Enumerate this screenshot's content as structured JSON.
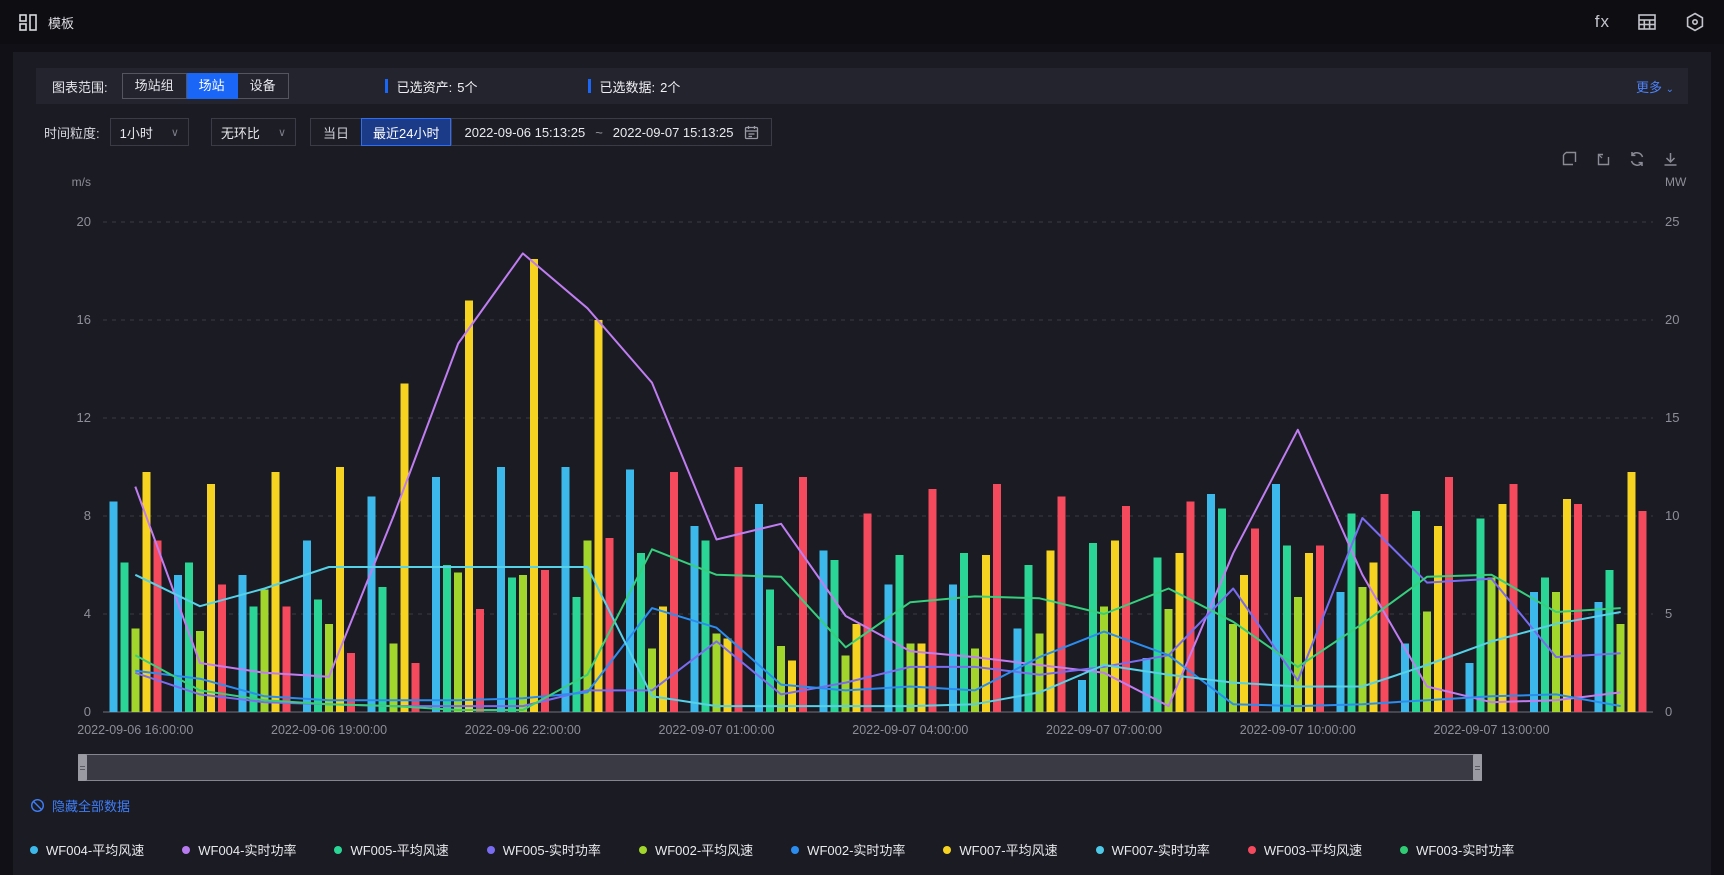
{
  "header": {
    "title": "模板",
    "fx_icon_label": "fx"
  },
  "filter": {
    "scope_label": "图表范围:",
    "scope_options": [
      "场站组",
      "场站",
      "设备"
    ],
    "scope_selected_index": 1,
    "assets_label": "已选资产:",
    "assets_value": "5个",
    "data_label": "已选数据:",
    "data_value": "2个",
    "more_label": "更多",
    "accent_color": "#1a66f7"
  },
  "time": {
    "granularity_label": "时间粒度:",
    "granularity_value": "1小时",
    "compare_value": "无环比",
    "today_label": "当日",
    "last24_label": "最近24小时",
    "range_start": "2022-09-06 15:13:25",
    "range_separator": "~",
    "range_end": "2022-09-07 15:13:25"
  },
  "footer": {
    "hide_all_label": "隐藏全部数据"
  },
  "legend": {
    "items": [
      {
        "label": "WF004-平均风速",
        "color": "#3cb9ea"
      },
      {
        "label": "WF004-实时功率",
        "color": "#b87af0"
      },
      {
        "label": "WF005-平均风速",
        "color": "#2bd596"
      },
      {
        "label": "WF005-实时功率",
        "color": "#7a6cf0"
      },
      {
        "label": "WF002-平均风速",
        "color": "#a2d62c"
      },
      {
        "label": "WF002-实时功率",
        "color": "#2b8df0"
      },
      {
        "label": "WF007-平均风速",
        "color": "#f6d321"
      },
      {
        "label": "WF007-实时功率",
        "color": "#4fc9e8"
      },
      {
        "label": "WF003-平均风速",
        "color": "#f5495e"
      },
      {
        "label": "WF003-实时功率",
        "color": "#30cc74"
      }
    ]
  },
  "chart_data": {
    "type": "mixed-bar-line",
    "grid": "dashed-horizontal",
    "x": [
      "2022-09-06 16:00:00",
      "2022-09-06 17:00:00",
      "2022-09-06 18:00:00",
      "2022-09-06 19:00:00",
      "2022-09-06 20:00:00",
      "2022-09-06 21:00:00",
      "2022-09-06 22:00:00",
      "2022-09-06 23:00:00",
      "2022-09-07 00:00:00",
      "2022-09-07 01:00:00",
      "2022-09-07 02:00:00",
      "2022-09-07 03:00:00",
      "2022-09-07 04:00:00",
      "2022-09-07 05:00:00",
      "2022-09-07 06:00:00",
      "2022-09-07 07:00:00",
      "2022-09-07 08:00:00",
      "2022-09-07 09:00:00",
      "2022-09-07 10:00:00",
      "2022-09-07 11:00:00",
      "2022-09-07 12:00:00",
      "2022-09-07 13:00:00",
      "2022-09-07 14:00:00",
      "2022-09-07 15:00:00"
    ],
    "x_tick_labels": [
      "2022-09-06 16:00:00",
      "2022-09-06 19:00:00",
      "2022-09-06 22:00:00",
      "2022-09-07 01:00:00",
      "2022-09-07 04:00:00",
      "2022-09-07 07:00:00",
      "2022-09-07 10:00:00",
      "2022-09-07 13:00:00"
    ],
    "x_tick_positions": [
      0,
      3,
      6,
      9,
      12,
      15,
      18,
      21
    ],
    "left_axis": {
      "unit": "m/s",
      "ticks": [
        0,
        4,
        8,
        12,
        16,
        20
      ],
      "min": 0,
      "max": 20
    },
    "right_axis": {
      "unit": "MW",
      "ticks": [
        0,
        5,
        10,
        15,
        20,
        25
      ],
      "min": 0,
      "max": 25
    },
    "bar_series": [
      {
        "name": "WF004-平均风速",
        "axis": "left",
        "color": "#3cb9ea",
        "values": [
          8.6,
          5.6,
          5.6,
          7.0,
          8.8,
          9.6,
          10.0,
          10.0,
          9.9,
          7.6,
          8.5,
          6.6,
          5.2,
          5.2,
          3.4,
          1.3,
          2.2,
          8.9,
          9.3,
          4.9,
          2.8,
          2.0,
          4.9,
          4.5
        ]
      },
      {
        "name": "WF005-平均风速",
        "axis": "left",
        "color": "#2bd596",
        "values": [
          6.1,
          6.1,
          4.3,
          4.6,
          5.1,
          6.0,
          5.5,
          4.7,
          6.5,
          7.0,
          5.0,
          6.2,
          6.4,
          6.5,
          6.0,
          6.9,
          6.3,
          8.3,
          6.8,
          8.1,
          8.2,
          7.9,
          5.5,
          5.8
        ]
      },
      {
        "name": "WF002-平均风速",
        "axis": "left",
        "color": "#a2d62c",
        "values": [
          3.4,
          3.3,
          5.0,
          3.6,
          2.8,
          5.7,
          5.6,
          7.0,
          2.6,
          3.2,
          2.7,
          2.3,
          2.8,
          2.6,
          3.2,
          4.3,
          4.2,
          3.6,
          4.7,
          5.1,
          4.1,
          5.5,
          4.9,
          3.6
        ]
      },
      {
        "name": "WF007-平均风速",
        "axis": "left",
        "color": "#f6d321",
        "values": [
          9.8,
          9.3,
          9.8,
          10.0,
          13.4,
          16.8,
          18.5,
          16.0,
          4.3,
          3.0,
          2.1,
          3.6,
          2.8,
          6.4,
          6.6,
          7.0,
          6.5,
          5.6,
          6.5,
          6.1,
          7.6,
          8.5,
          8.7,
          9.8
        ]
      },
      {
        "name": "WF003-平均风速",
        "axis": "left",
        "color": "#f5495e",
        "values": [
          7.0,
          5.2,
          4.3,
          2.4,
          2.0,
          4.2,
          5.8,
          7.1,
          9.8,
          10.0,
          9.6,
          8.1,
          9.1,
          9.3,
          8.8,
          8.4,
          8.6,
          7.5,
          6.8,
          8.9,
          9.6,
          9.3,
          8.5,
          8.2
        ]
      }
    ],
    "line_series": [
      {
        "name": "WF004-实时功率",
        "axis": "right",
        "color": "#c07df2",
        "values": [
          11.5,
          2.5,
          2.0,
          1.8,
          10.0,
          18.8,
          23.4,
          20.6,
          16.8,
          8.8,
          9.6,
          4.9,
          3.1,
          2.8,
          2.4,
          2.0,
          0.3,
          8.1,
          14.4,
          7.0,
          1.3,
          0.5,
          0.6,
          1.0
        ]
      },
      {
        "name": "WF005-实时功率",
        "axis": "right",
        "color": "#7a6cf0",
        "values": [
          2.0,
          0.9,
          0.5,
          0.4,
          0.3,
          0.3,
          0.3,
          1.1,
          1.1,
          3.6,
          0.9,
          1.5,
          2.3,
          2.3,
          1.9,
          2.3,
          2.9,
          6.3,
          1.6,
          9.9,
          6.6,
          6.8,
          2.8,
          3.0
        ]
      },
      {
        "name": "WF002-实时功率",
        "axis": "right",
        "color": "#2b8df0",
        "values": [
          2.1,
          1.7,
          0.8,
          0.6,
          0.6,
          0.6,
          0.7,
          1.0,
          5.3,
          4.3,
          1.4,
          1.1,
          1.3,
          1.1,
          2.8,
          4.1,
          2.9,
          0.4,
          0.3,
          0.4,
          0.6,
          0.8,
          0.9,
          0.3
        ]
      },
      {
        "name": "WF007-实时功率",
        "axis": "right",
        "color": "#55d1e8",
        "values": [
          7.0,
          5.4,
          6.3,
          7.4,
          7.4,
          7.4,
          7.4,
          7.4,
          0.8,
          0.3,
          0.3,
          0.3,
          0.3,
          0.4,
          1.0,
          2.4,
          1.9,
          1.5,
          1.3,
          1.3,
          2.4,
          3.6,
          4.5,
          5.1
        ]
      },
      {
        "name": "WF003-实时功率",
        "axis": "right",
        "color": "#35cf7d",
        "values": [
          2.9,
          1.1,
          0.6,
          0.4,
          0.3,
          0.1,
          0.1,
          1.9,
          8.3,
          7.0,
          6.9,
          3.3,
          5.6,
          5.9,
          5.8,
          5.0,
          6.3,
          4.6,
          2.3,
          4.5,
          6.9,
          7.0,
          5.1,
          5.3
        ]
      }
    ]
  }
}
